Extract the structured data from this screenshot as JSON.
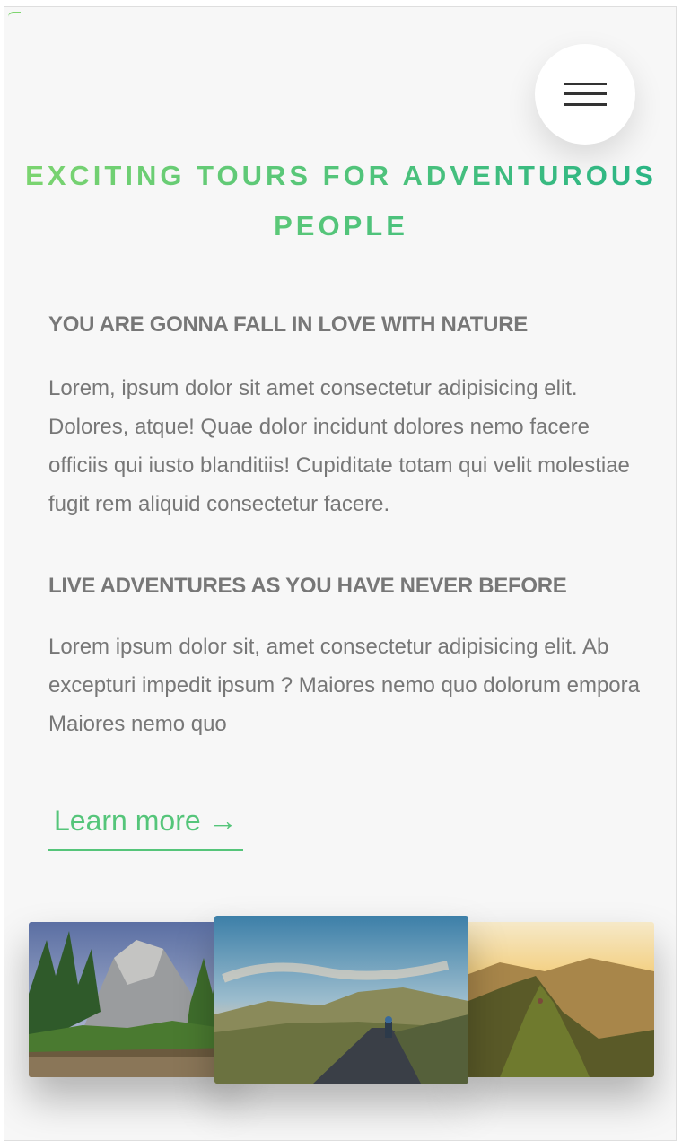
{
  "header": {
    "title": "Exciting tours for adventurous people"
  },
  "navigation": {
    "menu_icon": "hamburger-menu-icon"
  },
  "section_about": {
    "blocks": [
      {
        "heading": "You are gonna fall in love with nature",
        "text": "Lorem, ipsum dolor sit amet consectetur adipisicing elit. Dolores, atque! Quae dolor incidunt dolores nemo facere officiis qui iusto blanditiis! Cupiditate totam qui velit molestiae fugit rem aliquid consectetur facere."
      },
      {
        "heading": "Live adventures as you have never before",
        "text": "Lorem ipsum dolor sit, amet consectetur adipisicing elit. Ab excepturi impedit ipsum ? Maiores nemo quo dolorum empora Maiores nemo quo"
      }
    ],
    "cta_label": "Learn more →"
  },
  "composition": {
    "photos": [
      "forest-canyon-photo",
      "cyclist-road-photo",
      "mountain-ridge-sunset-photo"
    ]
  },
  "colors": {
    "primary_light": "#7ed56f",
    "primary_dark": "#28b485",
    "text_grey": "#777777",
    "background": "#f7f7f7"
  }
}
